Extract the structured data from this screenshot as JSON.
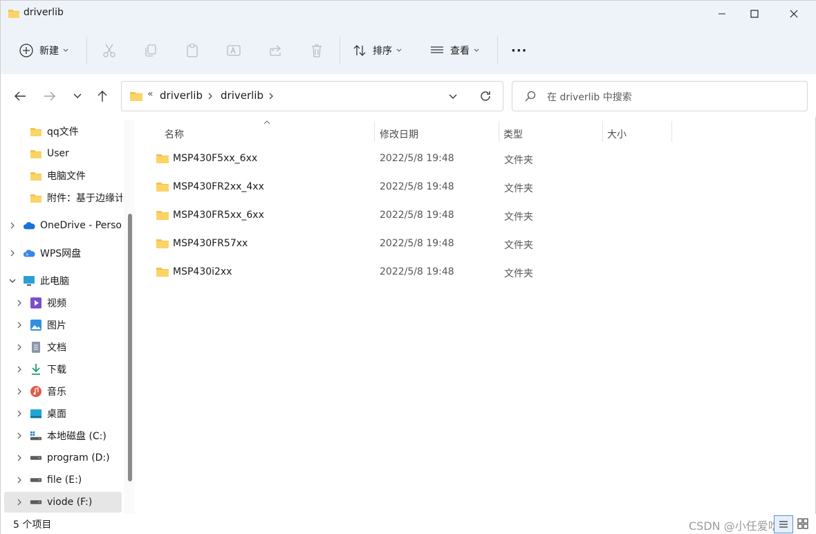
{
  "window": {
    "title": "driverlib",
    "controls": {
      "minimize": "minimize",
      "maximize": "maximize",
      "close": "close"
    }
  },
  "commandbar": {
    "new_label": "新建",
    "sort_label": "排序",
    "view_label": "查看",
    "more_label": "···"
  },
  "address": {
    "overflow": "«",
    "segments": [
      "driverlib",
      "driverlib"
    ]
  },
  "search": {
    "placeholder": "在 driverlib 中搜索"
  },
  "sidebar": {
    "items": [
      {
        "label": "qq文件",
        "icon": "folder-icon"
      },
      {
        "label": "User",
        "icon": "folder-icon"
      },
      {
        "label": "电脑文件",
        "icon": "folder-icon"
      },
      {
        "label": "附件：基于边缘计",
        "icon": "folder-icon"
      },
      {
        "label": "OneDrive - Perso",
        "icon": "onedrive-icon"
      },
      {
        "label": "WPS网盘",
        "icon": "wps-cloud-icon"
      },
      {
        "label": "此电脑",
        "icon": "this-pc-icon"
      },
      {
        "label": "视频",
        "icon": "videos-icon"
      },
      {
        "label": "图片",
        "icon": "pictures-icon"
      },
      {
        "label": "文档",
        "icon": "documents-icon"
      },
      {
        "label": "下载",
        "icon": "downloads-icon"
      },
      {
        "label": "音乐",
        "icon": "music-icon"
      },
      {
        "label": "桌面",
        "icon": "desktop-icon"
      },
      {
        "label": "本地磁盘 (C:)",
        "icon": "windows-drive-icon"
      },
      {
        "label": "program (D:)",
        "icon": "drive-icon"
      },
      {
        "label": "file (E:)",
        "icon": "drive-icon"
      },
      {
        "label": "viode (F:)",
        "icon": "drive-icon"
      }
    ]
  },
  "columns": {
    "name": "名称",
    "date": "修改日期",
    "type": "类型",
    "size": "大小"
  },
  "files": [
    {
      "name": "MSP430F5xx_6xx",
      "date": "2022/5/8 19:48",
      "type": "文件夹"
    },
    {
      "name": "MSP430FR2xx_4xx",
      "date": "2022/5/8 19:48",
      "type": "文件夹"
    },
    {
      "name": "MSP430FR5xx_6xx",
      "date": "2022/5/8 19:48",
      "type": "文件夹"
    },
    {
      "name": "MSP430FR57xx",
      "date": "2022/5/8 19:48",
      "type": "文件夹"
    },
    {
      "name": "MSP430i2xx",
      "date": "2022/5/8 19:48",
      "type": "文件夹"
    }
  ],
  "status": {
    "count": "5 个项目",
    "watermark": "CSDN @小任爱吃咱"
  },
  "colors": {
    "chrome_bg": "#eef3f9",
    "folder_yellow": "#f6c344",
    "accent": "#1e6fd0"
  }
}
